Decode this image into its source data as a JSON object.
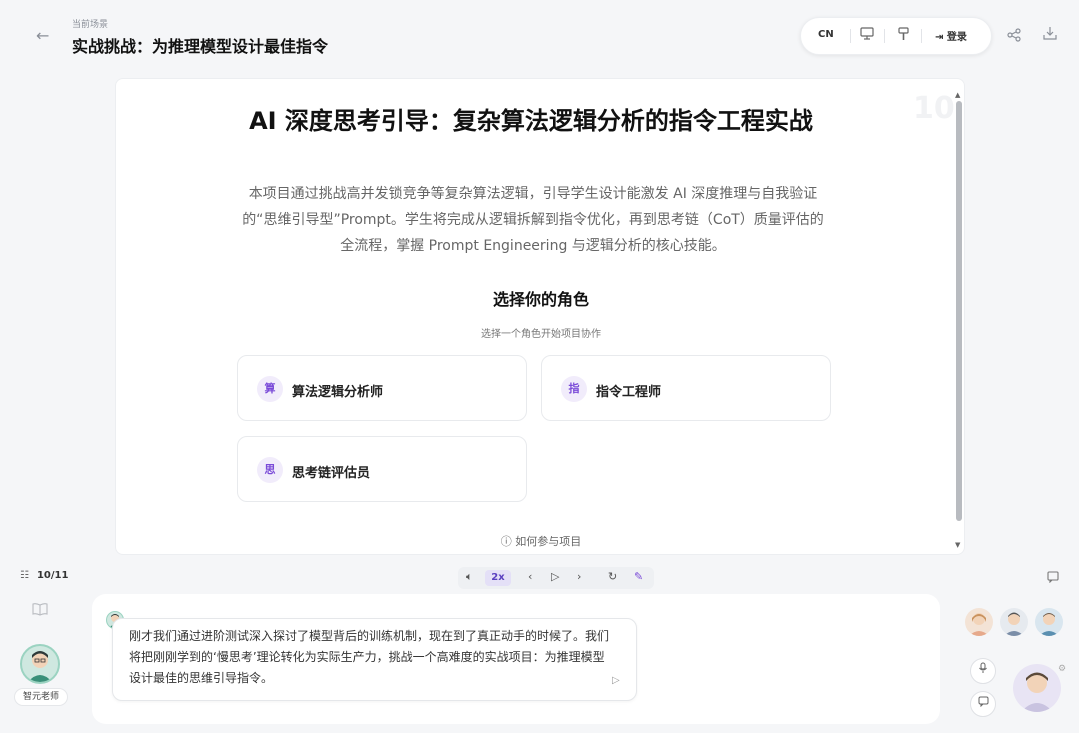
{
  "header": {
    "scene_label": "当前场景",
    "scene_title": "实战挑战：为推理模型设计最佳指令",
    "lang": "CN",
    "login": "登录"
  },
  "card": {
    "page_watermark": "10",
    "title": "AI 深度思考引导：复杂算法逻辑分析的指令工程实战",
    "description": "本项目通过挑战高并发锁竞争等复杂算法逻辑，引导学生设计能激发 AI 深度推理与自我验证的“思维引导型”Prompt。学生将完成从逻辑拆解到指令优化，再到思考链（CoT）质量评估的全流程，掌握 Prompt Engineering 与逻辑分析的核心技能。",
    "role_heading": "选择你的角色",
    "role_sub": "选择一个角色开始项目协作",
    "roles": [
      {
        "icon": "算",
        "label": "算法逻辑分析师"
      },
      {
        "icon": "指",
        "label": "指令工程师"
      },
      {
        "icon": "思",
        "label": "思考链评估员"
      }
    ],
    "how_to": "如何参与项目"
  },
  "controls": {
    "page": "10/11",
    "speed": "2x"
  },
  "chat": {
    "teacher_name": "智元老师",
    "message": "刚才我们通过进阶测试深入探讨了模型背后的训练机制，现在到了真正动手的时候了。我们将把刚刚学到的‘慢思考’理论转化为实际生产力，挑战一个高难度的实战项目：为推理模型设计最佳的思维引导指令。"
  },
  "icons": {
    "back": "arrow-left-icon",
    "present": "monitor-icon",
    "brush": "brush-icon",
    "login": "login-icon",
    "share": "share-icon",
    "download": "download-icon",
    "help": "help-circle-icon",
    "mic": "microphone-icon",
    "chat": "chat-bubble-icon"
  },
  "colors": {
    "accent": "#7a4ad8",
    "speed_bg": "#e4e0f7",
    "teacher_ring": "#9bd3c1"
  }
}
